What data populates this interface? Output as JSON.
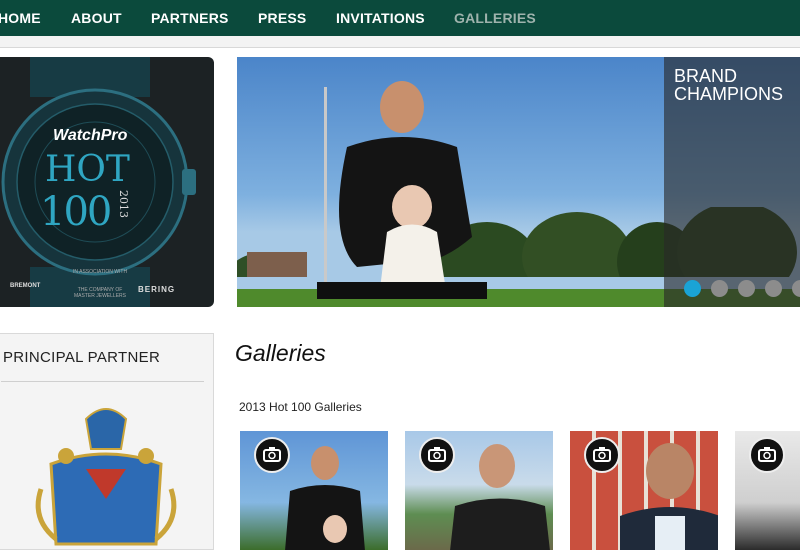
{
  "nav": {
    "items": [
      {
        "label": "HOME"
      },
      {
        "label": "ABOUT"
      },
      {
        "label": "PARTNERS"
      },
      {
        "label": "PRESS"
      },
      {
        "label": "INVITATIONS"
      },
      {
        "label": "GALLERIES"
      }
    ],
    "active": "GALLERIES",
    "bg": "#0b4a3c",
    "active_color": "#9fb3ad"
  },
  "promo": {
    "brand": "WatchPro",
    "hot": "HOT",
    "hundred": "100",
    "year": "2013",
    "assoc": "IN ASSOCIATION WITH",
    "footer_left": "BREMONT",
    "footer_mid": "THE COMPANY OF MASTER JEWELLERS",
    "footer_right": "BERING"
  },
  "hero": {
    "caption": "BRAND CHAMPIONS",
    "slide_count": 5,
    "active_slide": 1,
    "active_dot_color": "#1aa3d6"
  },
  "partner": {
    "title": "PRINCIPAL PARTNER",
    "crest_icon": "coat-of-arms-icon"
  },
  "galleries": {
    "title": "Galleries",
    "subtitle": "2013 Hot 100 Galleries",
    "thumb_icon": "camera-icon",
    "thumbs": [
      {
        "name": "golfer-with-child"
      },
      {
        "name": "man-on-coast"
      },
      {
        "name": "man-with-glasses"
      },
      {
        "name": "partial-photo"
      }
    ]
  }
}
